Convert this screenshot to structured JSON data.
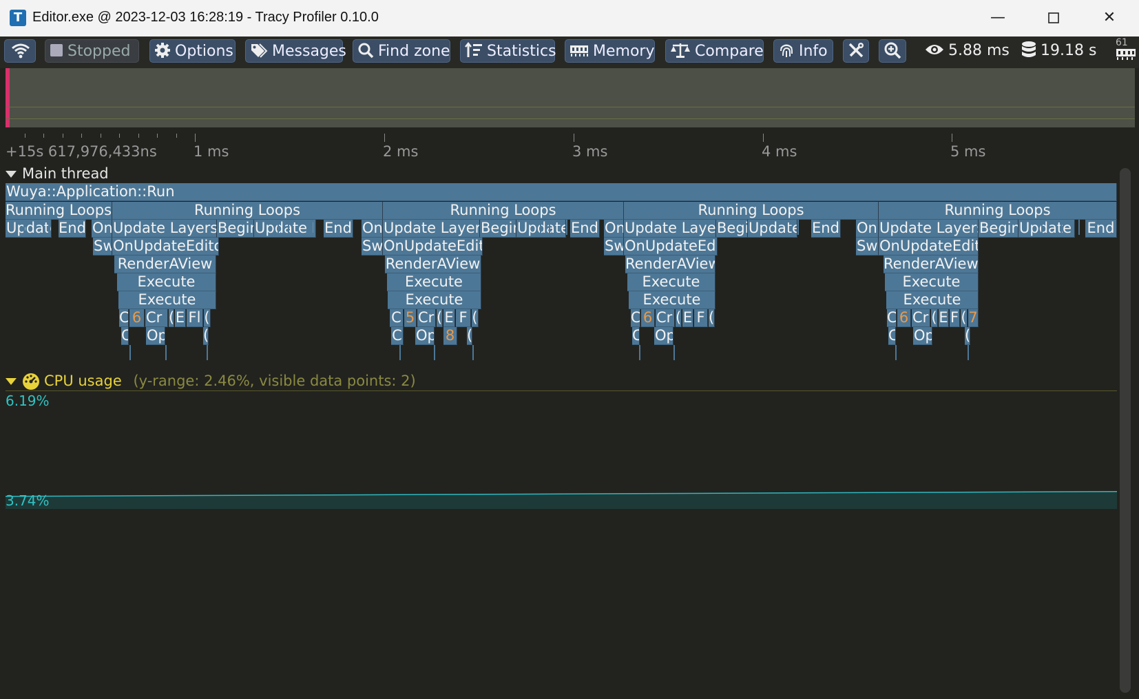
{
  "window": {
    "title": "Editor.exe @ 2023-12-03 16:28:19 - Tracy Profiler 0.10.0",
    "icon_letter": "T",
    "controls": [
      "minimize-icon",
      "maximize-icon",
      "close-icon"
    ]
  },
  "toolbar": {
    "connection_icon": "wifi-icon",
    "stopped_label": "Stopped",
    "options_label": "Options",
    "messages_label": "Messages",
    "find_zone_label": "Find zone",
    "statistics_label": "Statistics",
    "memory_label": "Memory",
    "compare_label": "Compare",
    "info_label": "Info",
    "tools_icon": "tools-icon",
    "zoom_icon": "zoom-icon",
    "view_time": "5.88 ms",
    "total_time": "19.18 s",
    "corner_badge": "61"
  },
  "ruler": {
    "origin": "+15s 617,976,433ns",
    "labels": [
      "1 ms",
      "2 ms",
      "3 ms",
      "4 ms",
      "5 ms"
    ]
  },
  "main_thread": {
    "title": "Main thread",
    "root_zone": "Wuya::Application::Run",
    "loop_label": "Running Loops",
    "row2": [
      "Update",
      "End",
      "On",
      "Update Layers",
      "Begin",
      "Update I",
      "End",
      "On",
      "Update Layers",
      "Begin",
      "Update",
      "End",
      "On",
      "Update Layers",
      "Begin",
      "Update",
      "End",
      "On",
      "Update Layers",
      "Begin",
      "Update I",
      "End"
    ],
    "row3": [
      "Sw",
      "OnUpdateEditor",
      "Sw",
      "OnUpdateEditor",
      "Sw",
      "OnUpdateEditor",
      "Sw",
      "OnUpdateEditor"
    ],
    "row4": [
      "RenderAView",
      "RenderAView",
      "RenderAView",
      "RenderAView"
    ],
    "execute_label": "Execute",
    "group_counts": [
      "6",
      "5",
      "6",
      "6",
      "7",
      "8"
    ],
    "tiny_labels": [
      "C",
      "Cr",
      "(",
      "E",
      "Fl",
      "F",
      "Op"
    ]
  },
  "cpu_usage": {
    "title": "CPU usage",
    "note": "(y-range: 2.46%, visible data points: 2)",
    "max_label": "6.19%",
    "min_label": "3.74%",
    "points": [
      4.0,
      4.1
    ]
  },
  "colors": {
    "zone": "#4d7796",
    "accent": "#d8306a",
    "cpu_line": "#2fb8c0",
    "cpu_title": "#e8d23a"
  }
}
